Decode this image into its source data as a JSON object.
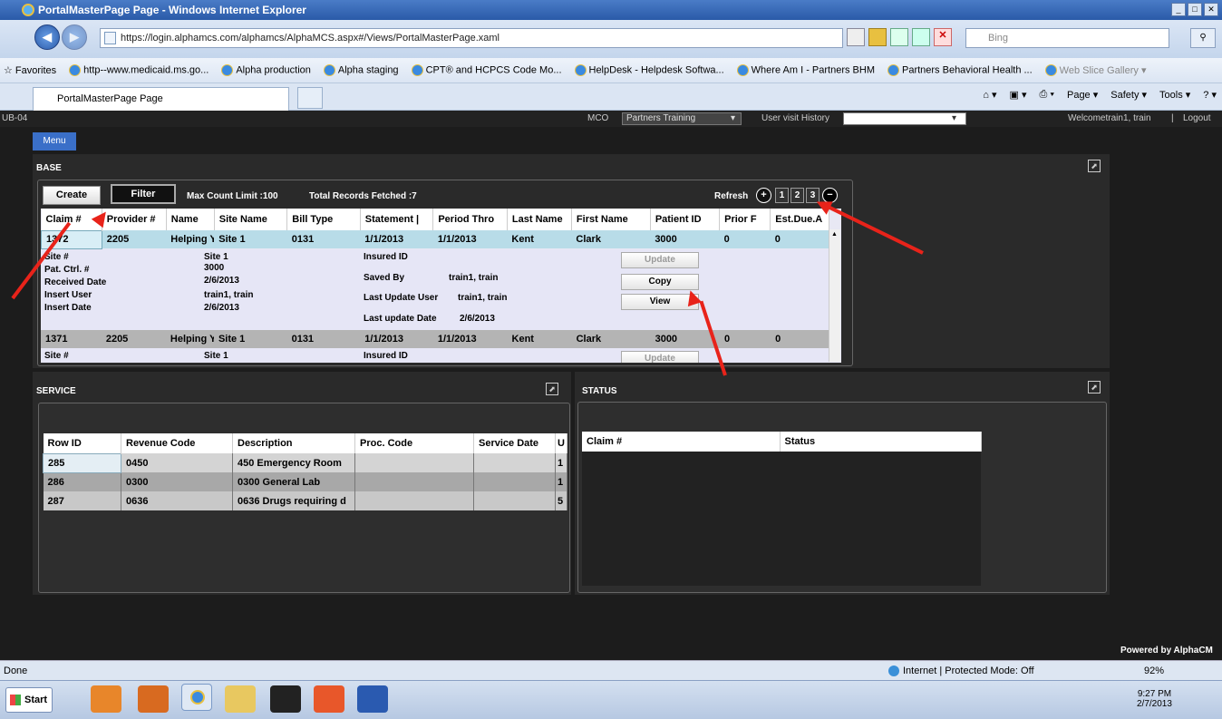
{
  "window": {
    "title": "PortalMasterPage Page - Windows Internet Explorer"
  },
  "browser": {
    "url": "https://login.alphamcs.com/alphamcs/AlphaMCS.aspx#/Views/PortalMasterPage.xaml",
    "search_placeholder": "Bing",
    "favorites_label": "Favorites",
    "favorites": [
      "http--www.medicaid.ms.go...",
      "Alpha production",
      "Alpha staging",
      "CPT® and HCPCS Code Mo...",
      "HelpDesk - Helpdesk Softwa...",
      "Where Am I - Partners BHM",
      "Partners Behavioral Health ...",
      "Web Slice Gallery ▾"
    ],
    "tab_title": "PortalMasterPage Page",
    "commands": [
      "Page ▾",
      "Safety ▾",
      "Tools ▾"
    ]
  },
  "appbar": {
    "title": "UB-04",
    "mco_label": "MCO",
    "mco_value": "Partners Training",
    "history_label": "User visit History",
    "welcome": "Welcometrain1, train",
    "logout": "Logout"
  },
  "menu": {
    "label": "Menu"
  },
  "base": {
    "title": "BASE",
    "create": "Create",
    "filter": "Filter",
    "max_count": "Max Count Limit :100",
    "total_fetched": "Total Records Fetched :7",
    "refresh": "Refresh",
    "pages": [
      "1",
      "2",
      "3"
    ],
    "plus": "+",
    "minus": "−",
    "columns": [
      "Claim #",
      "Provider #",
      "Name",
      "Site Name",
      "Bill Type",
      "Statement |",
      "Period Thro",
      "Last Name",
      "First Name",
      "Patient ID",
      "Prior F",
      "Est.Due.A"
    ],
    "rows": [
      [
        "1372",
        "2205",
        "Helping Yo",
        "Site 1",
        "0131",
        "1/1/2013",
        "1/1/2013",
        "Kent",
        "Clark",
        "3000",
        "0",
        "0"
      ],
      [
        "1371",
        "2205",
        "Helping Yo",
        "Site 1",
        "0131",
        "1/1/2013",
        "1/1/2013",
        "Kent",
        "Clark",
        "3000",
        "0",
        "0"
      ]
    ],
    "detail": {
      "site_label": "Site #",
      "site_value": "Site 1",
      "patctrl_label": "Pat. Ctrl. #",
      "patctrl_value": "3000",
      "received_label": "Received Date",
      "received_value": "2/6/2013",
      "insert_user_label": "Insert User",
      "insert_user_value": "train1, train",
      "insert_date_label": "Insert Date",
      "insert_date_value": "2/6/2013",
      "insured_label": "Insured ID",
      "saved_by_label": "Saved By",
      "saved_by_value": "train1, train",
      "last_update_user_label": "Last Update User",
      "last_update_user_value": "train1, train",
      "last_update_date_label": "Last update Date",
      "last_update_date_value": "2/6/2013",
      "update": "Update",
      "copy": "Copy",
      "view": "View"
    },
    "detail2": {
      "site_label": "Site #",
      "site_value": "Site 1",
      "insured_label": "Insured ID",
      "update": "Update"
    }
  },
  "service": {
    "title": "SERVICE",
    "columns": [
      "Row ID",
      "Revenue Code",
      "Description",
      "Proc. Code",
      "Service Date",
      "U"
    ],
    "rows": [
      [
        "285",
        "0450",
        "450 Emergency Room",
        "",
        "",
        "1"
      ],
      [
        "286",
        "0300",
        "0300 General Lab",
        "",
        "",
        "1"
      ],
      [
        "287",
        "0636",
        "0636 Drugs requiring d",
        "",
        "",
        "5"
      ]
    ]
  },
  "status": {
    "title": "STATUS",
    "columns": [
      "Claim #",
      "Status"
    ]
  },
  "powered": "Powered by AlphaCM",
  "statusbar": {
    "left": "Done",
    "zone": "Internet | Protected Mode: Off",
    "zoom": "92%"
  },
  "taskbar": {
    "start": "Start",
    "time": "9:27 PM",
    "date": "2/7/2013"
  }
}
